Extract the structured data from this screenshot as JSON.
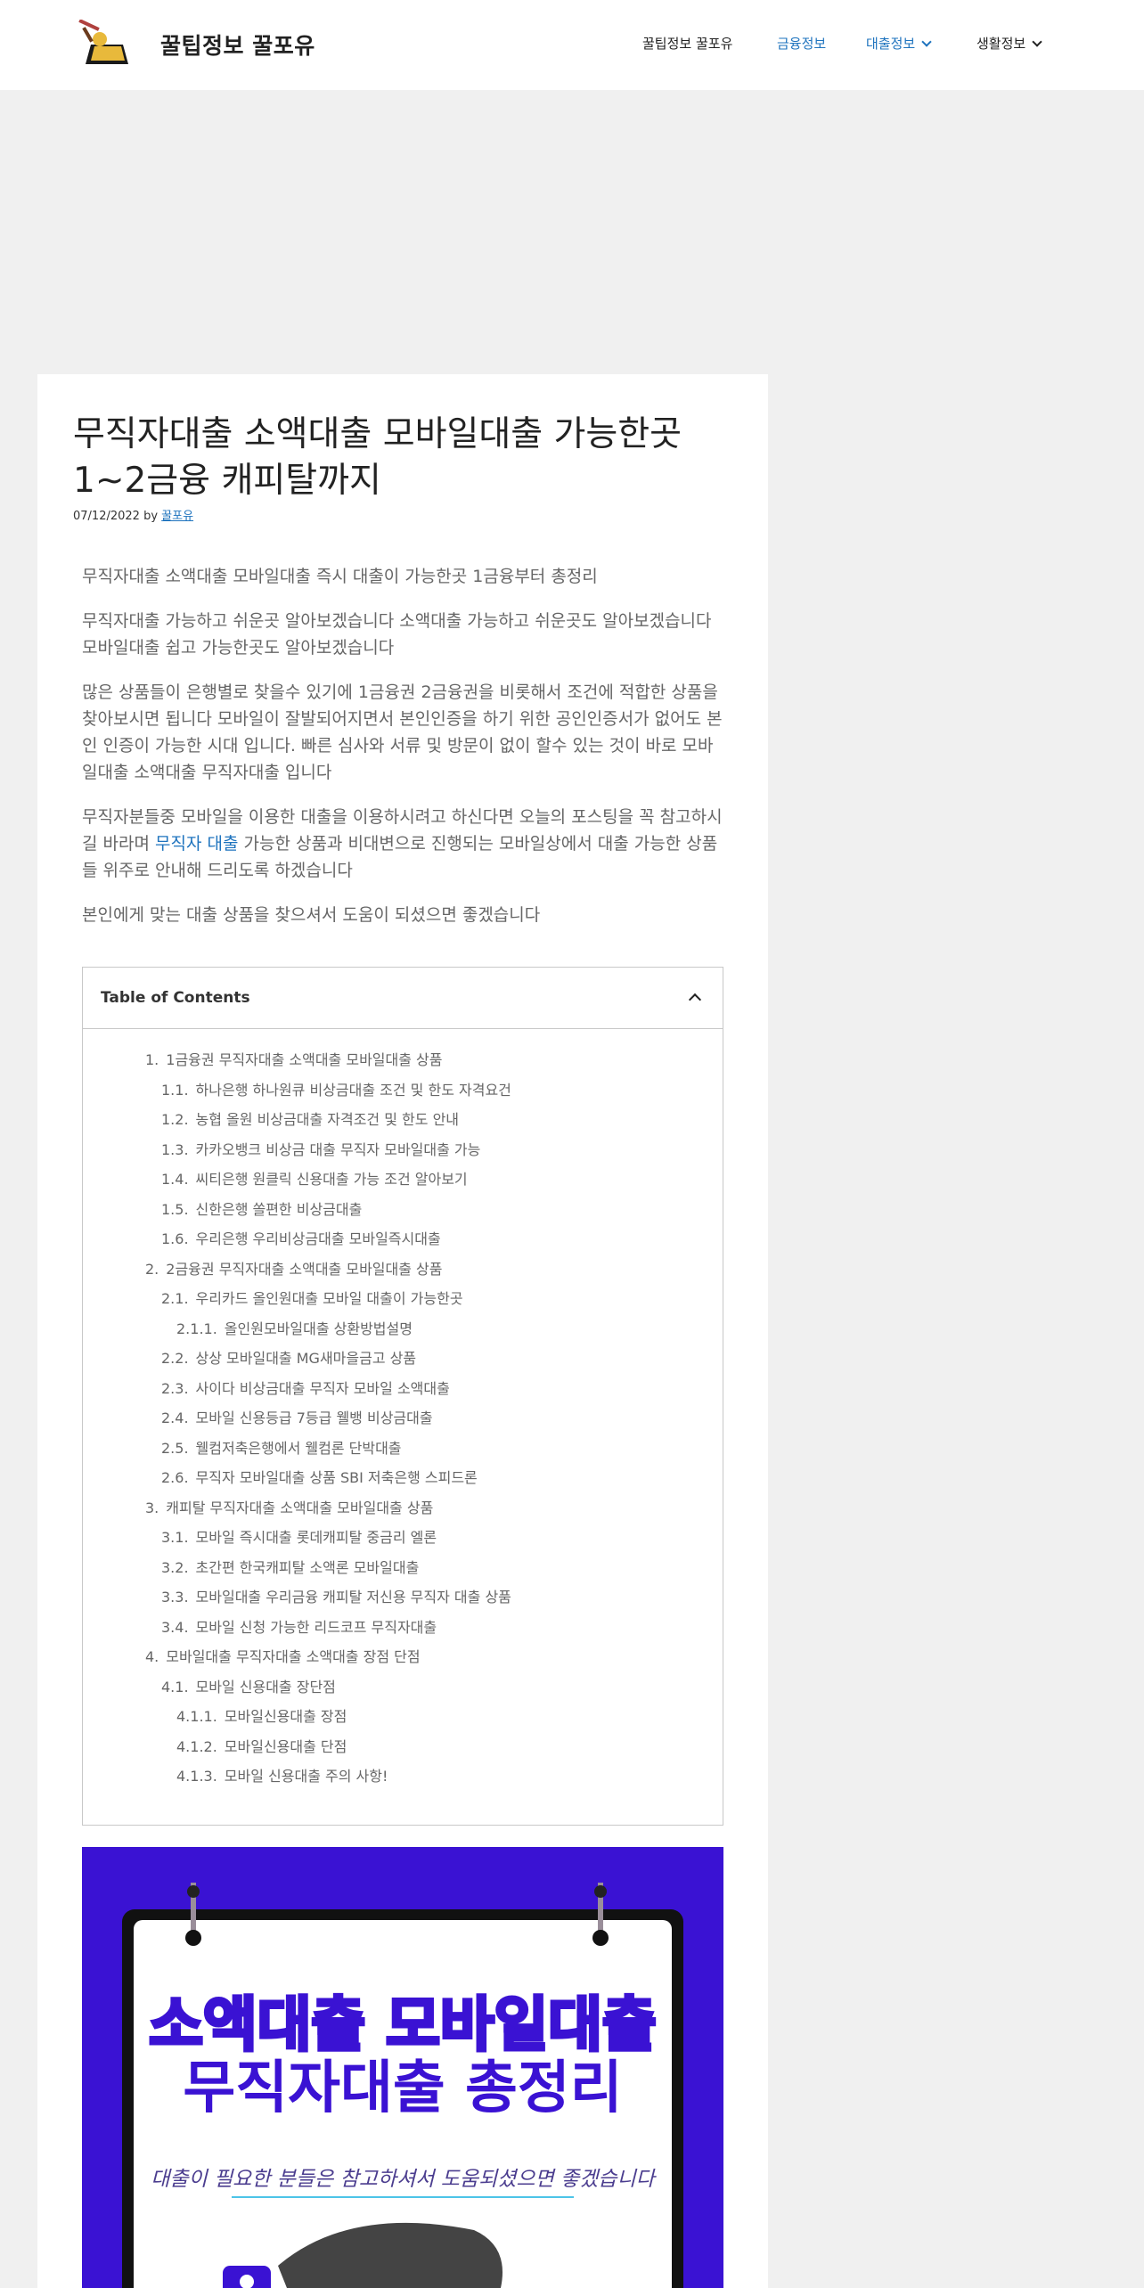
{
  "header": {
    "site_title": "꿀팁정보 꿀포유",
    "logo_icon": "logo-icon",
    "nav": [
      {
        "label": "꿀팁정보 꿀포유",
        "color": "#222222",
        "dropdown": false
      },
      {
        "label": "금융정보",
        "color": "#1e73be",
        "dropdown": false
      },
      {
        "label": "대출정보",
        "color": "#1e73be",
        "dropdown": true
      },
      {
        "label": "생활정보",
        "color": "#222222",
        "dropdown": true
      }
    ]
  },
  "article": {
    "title": "무직자대출 소액대출 모바일대출 가능한곳 1~2금융 캐피탈까지",
    "date": "07/12/2022",
    "by": "by",
    "author": "꿀포유",
    "paragraphs": [
      "무직자대출 소액대출 모바일대출 즉시 대출이 가능한곳 1금융부터 총정리",
      "무직자대출 가능하고 쉬운곳 알아보겠습니다 소액대출 가능하고 쉬운곳도 알아보겠습니다 모바일대출 쉽고 가능한곳도 알아보겠습니다",
      "많은 상품들이 은행별로 찾을수 있기에 1금융권 2금융권을 비롯해서 조건에 적합한 상품을 찾아보시면 됩니다 모바일이 잘발되어지면서 본인인증을 하기 위한 공인인증서가 없어도 본인 인증이 가능한 시대 입니다. 빠른 심사와 서류 및 방문이 없이 할수 있는 것이 바로 모바일대출 소액대출 무직자대출 입니다",
      "본인에게 맞는 대출 상품을 찾으셔서 도움이 되셨으면 좋겠습니다"
    ],
    "para4_before": "무직자분들중 모바일을 이용한 대출을 이용하시려고 하신다면 오늘의 포스팅을 꼭 참고하시길 바라며 ",
    "para4_link": "무직자 대출",
    "para4_after": " 가능한 상품과 비대변으로 진행되는 모바일상에서 대출 가능한 상품들 위주로 안내해 드리도록 하겠습니다"
  },
  "toc": {
    "title": "Table of Contents",
    "items": [
      {
        "num": "1.",
        "label": "1금융권 무직자대출 소액대출 모바일대출 상품",
        "level": 1
      },
      {
        "num": "1.1.",
        "label": "하나은행 하나원큐 비상금대출 조건 및 한도 자격요건",
        "level": 2
      },
      {
        "num": "1.2.",
        "label": "농협 올원 비상금대출 자격조건 및 한도 안내",
        "level": 2
      },
      {
        "num": "1.3.",
        "label": "카카오뱅크 비상금 대출 무직자 모바일대출 가능",
        "level": 2
      },
      {
        "num": "1.4.",
        "label": "씨티은행 원클릭 신용대출 가능 조건 알아보기",
        "level": 2
      },
      {
        "num": "1.5.",
        "label": "신한은행 쏠편한 비상금대출",
        "level": 2
      },
      {
        "num": "1.6.",
        "label": "우리은행 우리비상금대출 모바일즉시대출",
        "level": 2
      },
      {
        "num": "2.",
        "label": "2금융권 무직자대출 소액대출 모바일대출 상품",
        "level": 1
      },
      {
        "num": "2.1.",
        "label": "우리카드 올인원대출 모바일 대출이 가능한곳",
        "level": 2
      },
      {
        "num": "2.1.1.",
        "label": "올인원모바일대출 상환방법설명",
        "level": 3
      },
      {
        "num": "2.2.",
        "label": "상상 모바일대출 MG새마을금고 상품",
        "level": 2
      },
      {
        "num": "2.3.",
        "label": "사이다 비상금대출 무직자 모바일 소액대출",
        "level": 2
      },
      {
        "num": "2.4.",
        "label": "모바일 신용등급 7등급 웰뱅 비상금대출",
        "level": 2
      },
      {
        "num": "2.5.",
        "label": "웰컴저축은행에서 웰컴론 단박대출",
        "level": 2
      },
      {
        "num": "2.6.",
        "label": "무직자 모바일대출 상품 SBI 저축은행 스피드론",
        "level": 2
      },
      {
        "num": "3.",
        "label": "캐피탈 무직자대출 소액대출 모바일대출 상품",
        "level": 1
      },
      {
        "num": "3.1.",
        "label": "모바일 즉시대출 롯데캐피탈 중금리 엘론",
        "level": 2
      },
      {
        "num": "3.2.",
        "label": "초간편 한국캐피탈 소액론 모바일대출",
        "level": 2
      },
      {
        "num": "3.3.",
        "label": "모바일대출 우리금융 캐피탈 저신용 무직자 대출 상품",
        "level": 2
      },
      {
        "num": "3.4.",
        "label": "모바일 신청 가능한 리드코프 무직자대출",
        "level": 2
      },
      {
        "num": "4.",
        "label": "모바일대출 무직자대출 소액대출 장점 단점",
        "level": 1
      },
      {
        "num": "4.1.",
        "label": "모바일 신용대출 장단점",
        "level": 2
      },
      {
        "num": "4.1.1.",
        "label": "모바일신용대출 장점",
        "level": 3
      },
      {
        "num": "4.1.2.",
        "label": "모바일신용대출 단점",
        "level": 3
      },
      {
        "num": "4.1.3.",
        "label": "모바일 신용대출 주의 사항!",
        "level": 3
      }
    ]
  },
  "featured_image": {
    "line1": "소액대출 모바일대출",
    "line2": "무직자대출 총정리",
    "line3": "대출이 필요한 분들은 참고하셔서 도움되셨으면 좋겠습니다",
    "background": "#3a12d3"
  }
}
